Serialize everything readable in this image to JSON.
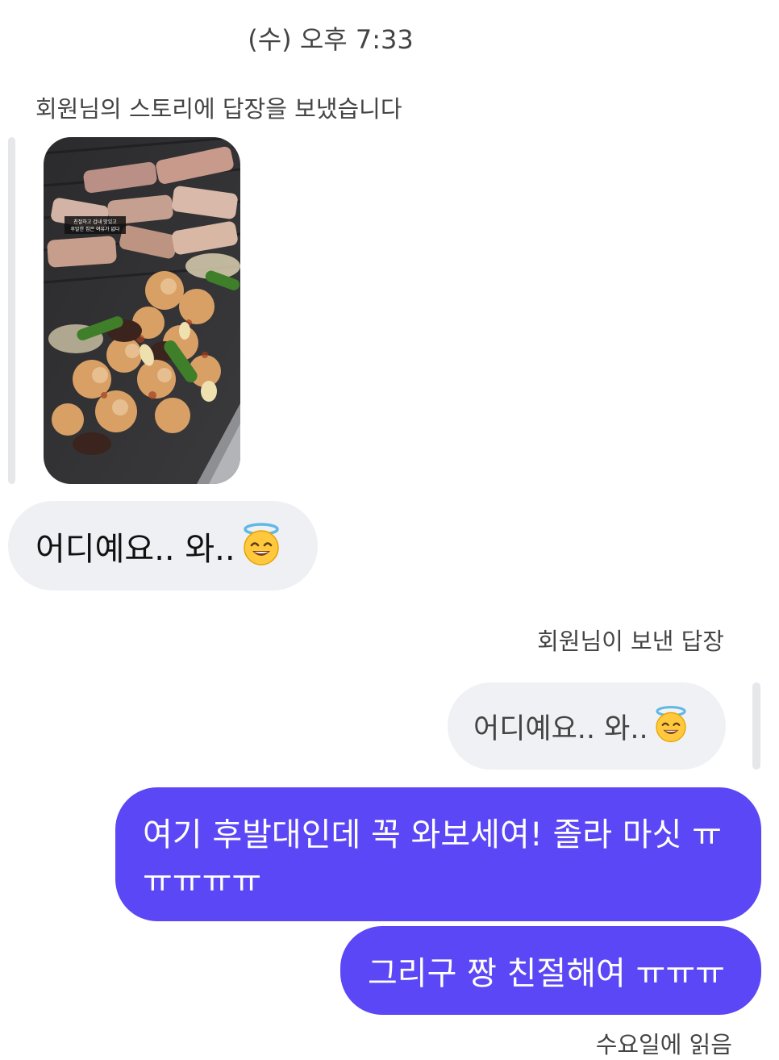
{
  "chat": {
    "timestamp": "(수) 오후 7:33",
    "story_reply_label": "회원님의 스토리에 답장을 보냈습니다",
    "story_image": {
      "caption_line1": "친절하고 겁내 맛있고",
      "caption_line2": "후발한 집은 여유가 없다"
    },
    "incoming_message": "어디예요.. 와..",
    "incoming_emoji": "smiling-face-with-halo",
    "reply_label": "회원님이 보낸 답장",
    "quoted_message": "어디예요.. 와..",
    "quoted_emoji": "smiling-face-with-halo",
    "outgoing_messages": [
      "여기 후발대인데 꼭 와보세여! 졸라 마싯 ㅠㅠㅠㅠㅠ",
      "그리구 짱 친절해여 ㅠㅠㅠ"
    ],
    "read_receipt": "수요일에 읽음"
  },
  "colors": {
    "outgoing_bubble": "#5b47f5",
    "incoming_bubble": "#eff0f3"
  }
}
